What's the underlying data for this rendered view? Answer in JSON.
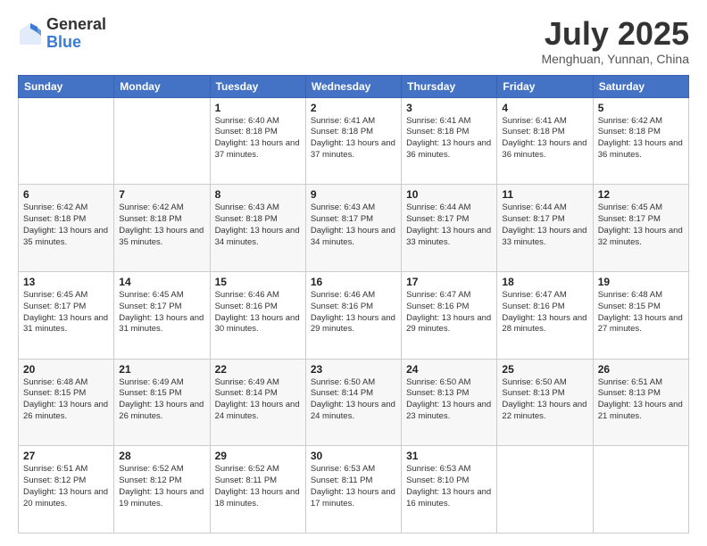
{
  "logo": {
    "general": "General",
    "blue": "Blue"
  },
  "header": {
    "month": "July 2025",
    "location": "Menghuan, Yunnan, China"
  },
  "weekdays": [
    "Sunday",
    "Monday",
    "Tuesday",
    "Wednesday",
    "Thursday",
    "Friday",
    "Saturday"
  ],
  "weeks": [
    [
      {
        "day": "",
        "info": ""
      },
      {
        "day": "",
        "info": ""
      },
      {
        "day": "1",
        "info": "Sunrise: 6:40 AM\nSunset: 8:18 PM\nDaylight: 13 hours and 37 minutes."
      },
      {
        "day": "2",
        "info": "Sunrise: 6:41 AM\nSunset: 8:18 PM\nDaylight: 13 hours and 37 minutes."
      },
      {
        "day": "3",
        "info": "Sunrise: 6:41 AM\nSunset: 8:18 PM\nDaylight: 13 hours and 36 minutes."
      },
      {
        "day": "4",
        "info": "Sunrise: 6:41 AM\nSunset: 8:18 PM\nDaylight: 13 hours and 36 minutes."
      },
      {
        "day": "5",
        "info": "Sunrise: 6:42 AM\nSunset: 8:18 PM\nDaylight: 13 hours and 36 minutes."
      }
    ],
    [
      {
        "day": "6",
        "info": "Sunrise: 6:42 AM\nSunset: 8:18 PM\nDaylight: 13 hours and 35 minutes."
      },
      {
        "day": "7",
        "info": "Sunrise: 6:42 AM\nSunset: 8:18 PM\nDaylight: 13 hours and 35 minutes."
      },
      {
        "day": "8",
        "info": "Sunrise: 6:43 AM\nSunset: 8:18 PM\nDaylight: 13 hours and 34 minutes."
      },
      {
        "day": "9",
        "info": "Sunrise: 6:43 AM\nSunset: 8:17 PM\nDaylight: 13 hours and 34 minutes."
      },
      {
        "day": "10",
        "info": "Sunrise: 6:44 AM\nSunset: 8:17 PM\nDaylight: 13 hours and 33 minutes."
      },
      {
        "day": "11",
        "info": "Sunrise: 6:44 AM\nSunset: 8:17 PM\nDaylight: 13 hours and 33 minutes."
      },
      {
        "day": "12",
        "info": "Sunrise: 6:45 AM\nSunset: 8:17 PM\nDaylight: 13 hours and 32 minutes."
      }
    ],
    [
      {
        "day": "13",
        "info": "Sunrise: 6:45 AM\nSunset: 8:17 PM\nDaylight: 13 hours and 31 minutes."
      },
      {
        "day": "14",
        "info": "Sunrise: 6:45 AM\nSunset: 8:17 PM\nDaylight: 13 hours and 31 minutes."
      },
      {
        "day": "15",
        "info": "Sunrise: 6:46 AM\nSunset: 8:16 PM\nDaylight: 13 hours and 30 minutes."
      },
      {
        "day": "16",
        "info": "Sunrise: 6:46 AM\nSunset: 8:16 PM\nDaylight: 13 hours and 29 minutes."
      },
      {
        "day": "17",
        "info": "Sunrise: 6:47 AM\nSunset: 8:16 PM\nDaylight: 13 hours and 29 minutes."
      },
      {
        "day": "18",
        "info": "Sunrise: 6:47 AM\nSunset: 8:16 PM\nDaylight: 13 hours and 28 minutes."
      },
      {
        "day": "19",
        "info": "Sunrise: 6:48 AM\nSunset: 8:15 PM\nDaylight: 13 hours and 27 minutes."
      }
    ],
    [
      {
        "day": "20",
        "info": "Sunrise: 6:48 AM\nSunset: 8:15 PM\nDaylight: 13 hours and 26 minutes."
      },
      {
        "day": "21",
        "info": "Sunrise: 6:49 AM\nSunset: 8:15 PM\nDaylight: 13 hours and 26 minutes."
      },
      {
        "day": "22",
        "info": "Sunrise: 6:49 AM\nSunset: 8:14 PM\nDaylight: 13 hours and 24 minutes."
      },
      {
        "day": "23",
        "info": "Sunrise: 6:50 AM\nSunset: 8:14 PM\nDaylight: 13 hours and 24 minutes."
      },
      {
        "day": "24",
        "info": "Sunrise: 6:50 AM\nSunset: 8:13 PM\nDaylight: 13 hours and 23 minutes."
      },
      {
        "day": "25",
        "info": "Sunrise: 6:50 AM\nSunset: 8:13 PM\nDaylight: 13 hours and 22 minutes."
      },
      {
        "day": "26",
        "info": "Sunrise: 6:51 AM\nSunset: 8:13 PM\nDaylight: 13 hours and 21 minutes."
      }
    ],
    [
      {
        "day": "27",
        "info": "Sunrise: 6:51 AM\nSunset: 8:12 PM\nDaylight: 13 hours and 20 minutes."
      },
      {
        "day": "28",
        "info": "Sunrise: 6:52 AM\nSunset: 8:12 PM\nDaylight: 13 hours and 19 minutes."
      },
      {
        "day": "29",
        "info": "Sunrise: 6:52 AM\nSunset: 8:11 PM\nDaylight: 13 hours and 18 minutes."
      },
      {
        "day": "30",
        "info": "Sunrise: 6:53 AM\nSunset: 8:11 PM\nDaylight: 13 hours and 17 minutes."
      },
      {
        "day": "31",
        "info": "Sunrise: 6:53 AM\nSunset: 8:10 PM\nDaylight: 13 hours and 16 minutes."
      },
      {
        "day": "",
        "info": ""
      },
      {
        "day": "",
        "info": ""
      }
    ]
  ]
}
